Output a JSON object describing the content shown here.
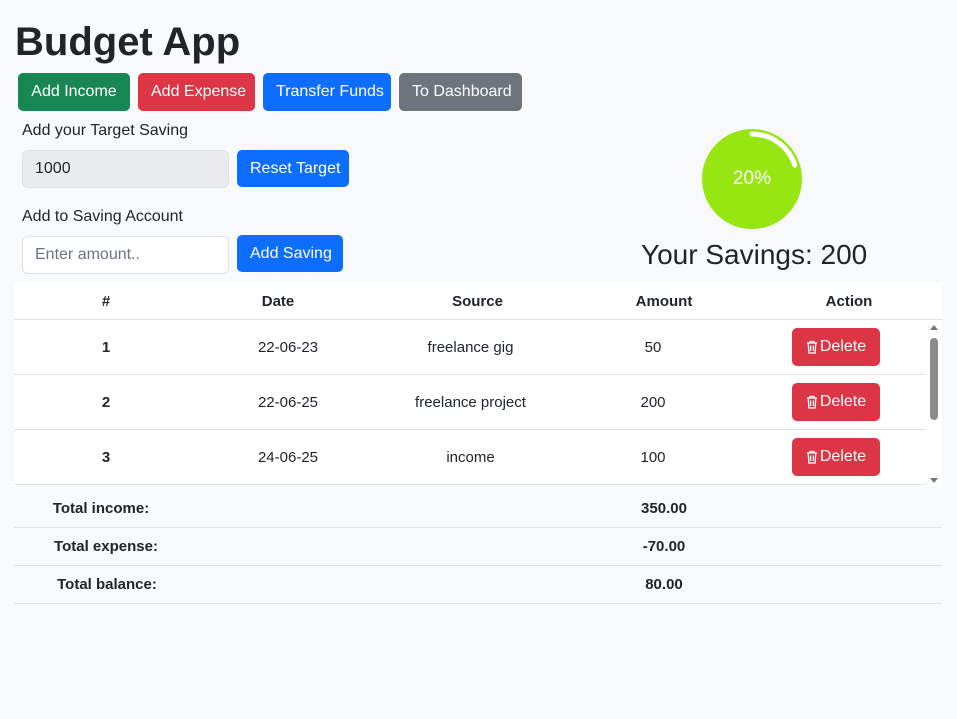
{
  "app": {
    "title": "Budget App"
  },
  "toolbar": {
    "add_income": "Add Income",
    "add_expense": "Add Expense",
    "transfer_funds": "Transfer Funds",
    "to_dashboard": "To Dashboard"
  },
  "target": {
    "label": "Add your Target Saving",
    "value": "1000",
    "reset_button": "Reset Target"
  },
  "saving": {
    "label": "Add to Saving Account",
    "placeholder": "Enter amount..",
    "add_button": "Add Saving"
  },
  "progress": {
    "percent_text": "20%",
    "fraction": 0.2,
    "fill_color": "#97e612",
    "ring_color": "#ffffff"
  },
  "savings_summary": "Your Savings: 200",
  "table": {
    "headers": [
      "#",
      "Date",
      "Source",
      "Amount",
      "Action"
    ],
    "rows": [
      {
        "num": "1",
        "date": "22-06-23",
        "source": "freelance gig",
        "amount": "50",
        "action": "Delete"
      },
      {
        "num": "2",
        "date": "22-06-25",
        "source": "freelance project",
        "amount": "200",
        "action": "Delete"
      },
      {
        "num": "3",
        "date": "24-06-25",
        "source": "income",
        "amount": "100",
        "action": "Delete"
      }
    ]
  },
  "totals": {
    "income_label": "Total income:",
    "income_value": "350.00",
    "expense_label": "Total expense:",
    "expense_value": "-70.00",
    "balance_label": "Total balance:",
    "balance_value": "80.00"
  },
  "colors": {
    "success": "#198754",
    "danger": "#dc3545",
    "primary": "#0d6efd",
    "secondary": "#6c757d"
  }
}
